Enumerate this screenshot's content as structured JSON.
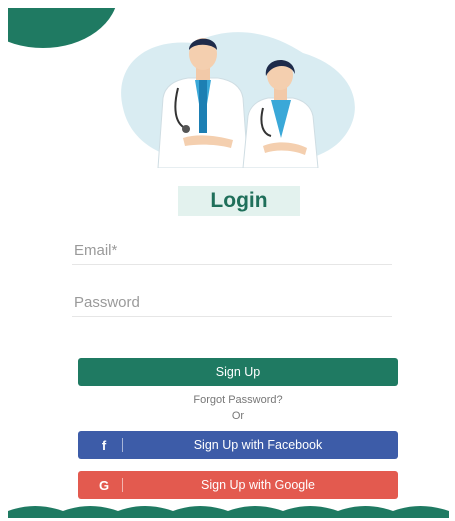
{
  "login": {
    "title": "Login",
    "email_placeholder": "Email*",
    "password_placeholder": "Password",
    "signup_label": "Sign Up",
    "forgot_label": "Forgot Password?",
    "or_label": "Or",
    "facebook_label": "Sign Up with Facebook",
    "facebook_icon": "f",
    "google_label": "Sign Up with Google",
    "google_icon": "G"
  },
  "colors": {
    "brand_green": "#1f7a62",
    "facebook_blue": "#3d5ca8",
    "google_red": "#e35a4f",
    "title_bg": "#e3f2ee"
  },
  "icons": {
    "hero": "doctors-illustration",
    "facebook": "facebook-icon",
    "google": "google-icon"
  }
}
